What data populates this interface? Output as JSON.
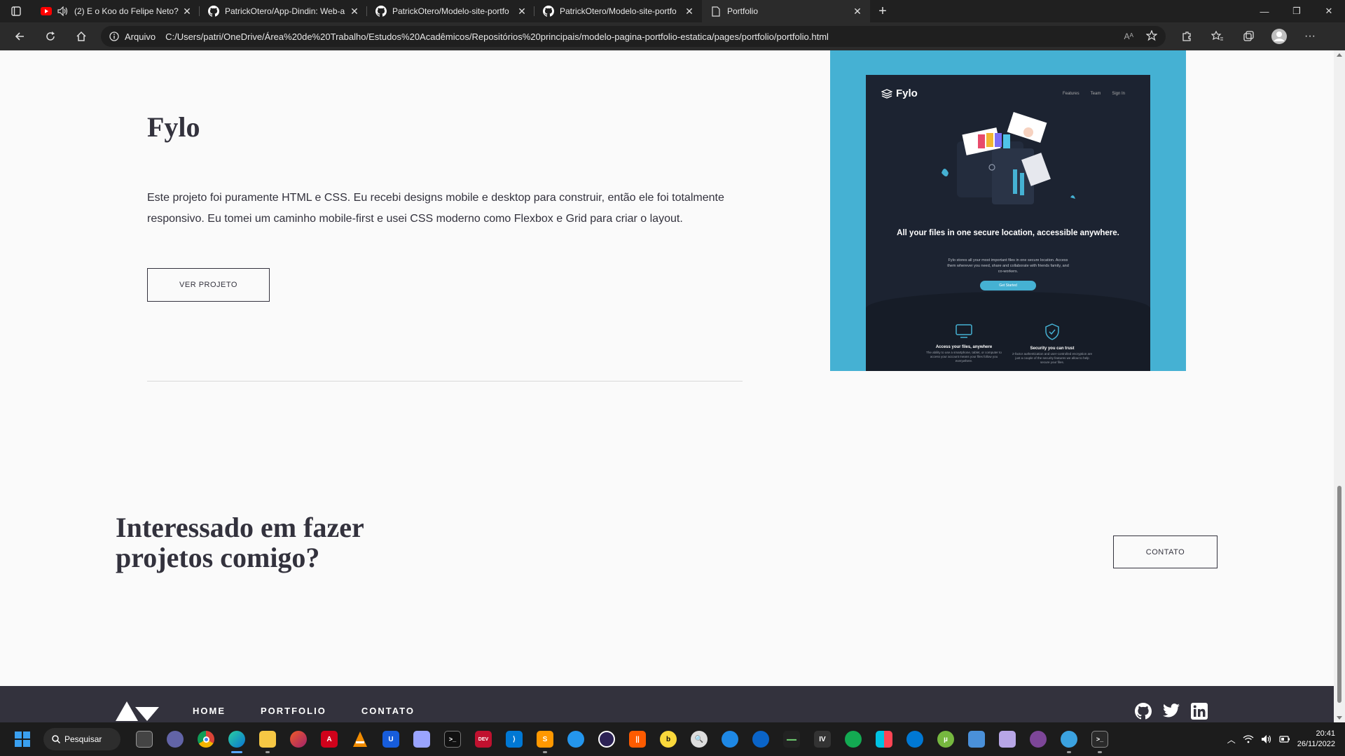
{
  "browser": {
    "tabs": [
      {
        "title": "(2) E o Koo do Felipe Neto?",
        "icon": "youtube-icon",
        "muted_icon": "speaker-icon"
      },
      {
        "title": "PatrickOtero/App-Dindin: Web-a",
        "icon": "github-icon"
      },
      {
        "title": "PatrickOtero/Modelo-site-portfo",
        "icon": "github-icon"
      },
      {
        "title": "PatrickOtero/Modelo-site-portfo",
        "icon": "github-icon"
      },
      {
        "title": "Portfolio",
        "icon": "page-icon"
      }
    ],
    "address": {
      "info_label": "Arquivo",
      "url": "C:/Users/patri/OneDrive/Área%20de%20Trabalho/Estudos%20Acadêmicos/Repositórios%20principais/modelo-pagina-portfolio-estatica/pages/portfolio/portfolio.html"
    }
  },
  "page": {
    "project": {
      "title": "Fylo",
      "description": "Este projeto foi puramente HTML e CSS. Eu recebi designs mobile e desktop para construir, então ele foi totalmente responsivo. Eu tomei um caminho mobile-first e usei CSS moderno como Flexbox e Grid para criar o layout.",
      "button": "VER PROJETO",
      "screenshot": {
        "logo": "Fylo",
        "nav": [
          "Features",
          "Team",
          "Sign In"
        ],
        "hero": "All your files in one secure location, accessible anywhere.",
        "sub": "Fylo stores all your most important files in one secure location. Access them wherever you need, share and collaborate with friends family, and co-workers.",
        "cta": "Get Started",
        "features": [
          {
            "title": "Access your files, anywhere",
            "desc": "The ability to use a smartphone, tablet, or computer to access your account means your files follow you everywhere."
          },
          {
            "title": "Security you can trust",
            "desc": "2-factor authentication and user-controlled encryption are just a couple of the security features we allow to help secure your files."
          }
        ]
      }
    },
    "cta": {
      "heading": "Interessado em fazer projetos comigo?",
      "button": "CONTATO"
    },
    "footer": {
      "nav": [
        "HOME",
        "PORTFOLIO",
        "CONTATO"
      ],
      "social": [
        "github-icon",
        "twitter-icon",
        "linkedin-icon"
      ]
    }
  },
  "taskbar": {
    "search_label": "Pesquisar",
    "time": "20:41",
    "date": "26/11/2022"
  },
  "colors": {
    "accent": "#45b1d3",
    "dark": "#33323d",
    "page_bg": "#fafafa"
  }
}
